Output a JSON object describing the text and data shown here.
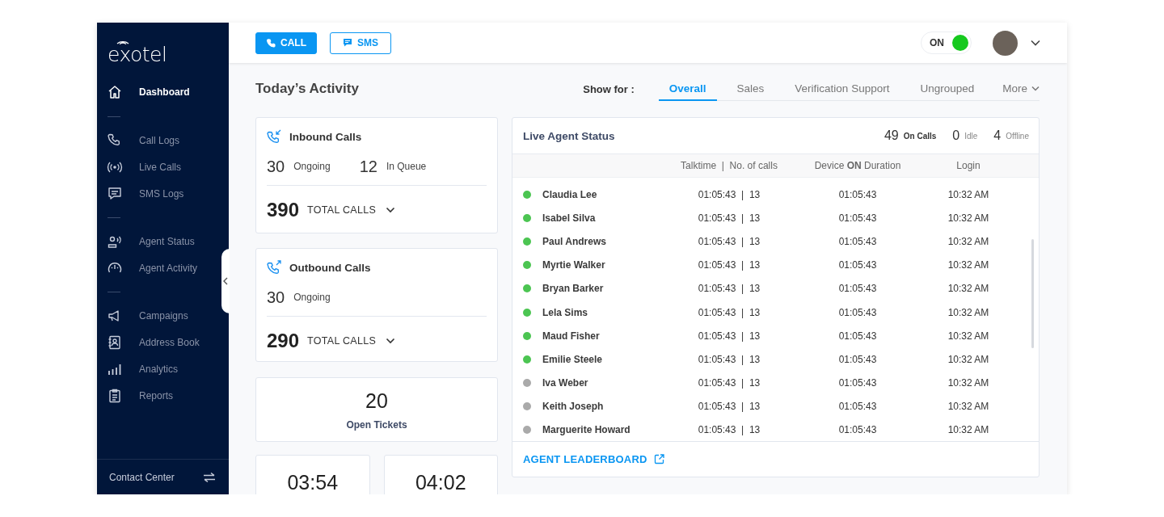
{
  "sidebar": {
    "logo": "exotel",
    "sections": [
      {
        "items": [
          {
            "label": "Dashboard",
            "selected": true
          }
        ]
      },
      {
        "items": [
          {
            "label": "Call Logs",
            "selected": false
          },
          {
            "label": "Live Calls",
            "selected": false
          },
          {
            "label": "SMS Logs",
            "selected": false
          }
        ]
      },
      {
        "items": [
          {
            "label": "Agent Status",
            "selected": false
          },
          {
            "label": "Agent Activity",
            "selected": false
          }
        ]
      },
      {
        "items": [
          {
            "label": "Campaigns",
            "selected": false
          },
          {
            "label": "Address Book",
            "selected": false
          },
          {
            "label": "Analytics",
            "selected": false
          },
          {
            "label": "Reports",
            "selected": false
          }
        ]
      }
    ],
    "footer": "Contact Center"
  },
  "topbar": {
    "buttons": [
      {
        "label": "CALL",
        "kind": "primary"
      },
      {
        "label": "SMS",
        "kind": "outline"
      }
    ],
    "status_toggle": {
      "label": "ON",
      "on": true
    }
  },
  "activity": {
    "title": "Today’s Activity",
    "show_for_label": "Show for :",
    "tabs": [
      {
        "label": "Overall",
        "selected": true
      },
      {
        "label": "Sales",
        "selected": false
      },
      {
        "label": "Verification Support",
        "selected": false
      },
      {
        "label": "Ungrouped",
        "selected": false
      }
    ],
    "more": "More"
  },
  "inbound": {
    "title": "Inbound Calls",
    "stats": [
      {
        "value": "30",
        "label": "Ongoing"
      },
      {
        "value": "12",
        "label": "In Queue"
      }
    ],
    "total": "390",
    "total_label": "TOTAL CALLS"
  },
  "outbound": {
    "title": "Outbound Calls",
    "stats": [
      {
        "value": "30",
        "label": "Ongoing"
      }
    ],
    "total": "290",
    "total_label": "TOTAL CALLS"
  },
  "tickets": {
    "value": "20",
    "label": "Open Tickets"
  },
  "timers": [
    "03:54",
    "04:02"
  ],
  "live_agent_status": {
    "title": "Live Agent Status",
    "summary": [
      {
        "value": "49",
        "label": "On Calls",
        "kind": "main"
      },
      {
        "value": "0",
        "label": "Idle",
        "kind": "minor"
      },
      {
        "value": "4",
        "label": "Offline",
        "kind": "minor"
      }
    ],
    "columns": [
      "Talktime  |  No. of calls",
      "Device **ON** Duration",
      "Login"
    ],
    "rows": [
      {
        "name": "Claudia Lee",
        "color": "#4cc552",
        "talktime": "01:05:43  |  13",
        "device_on": "01:05:43",
        "login": "10:32 AM"
      },
      {
        "name": "Isabel Silva",
        "color": "#4cc552",
        "talktime": "01:05:43  |  13",
        "device_on": "01:05:43",
        "login": "10:32 AM"
      },
      {
        "name": "Paul Andrews",
        "color": "#4cc552",
        "talktime": "01:05:43  |  13",
        "device_on": "01:05:43",
        "login": "10:32 AM"
      },
      {
        "name": "Myrtie Walker",
        "color": "#4cc552",
        "talktime": "01:05:43  |  13",
        "device_on": "01:05:43",
        "login": "10:32 AM"
      },
      {
        "name": "Bryan Barker",
        "color": "#4cc552",
        "talktime": "01:05:43  |  13",
        "device_on": "01:05:43",
        "login": "10:32 AM"
      },
      {
        "name": "Lela Sims",
        "color": "#4cc552",
        "talktime": "01:05:43  |  13",
        "device_on": "01:05:43",
        "login": "10:32 AM"
      },
      {
        "name": "Maud Fisher",
        "color": "#4cc552",
        "talktime": "01:05:43  |  13",
        "device_on": "01:05:43",
        "login": "10:32 AM"
      },
      {
        "name": "Emilie Steele",
        "color": "#4cc552",
        "talktime": "01:05:43  |  13",
        "device_on": "01:05:43",
        "login": "10:32 AM"
      },
      {
        "name": "Iva Weber",
        "color": "#aaaaaa",
        "talktime": "01:05:43  |  13",
        "device_on": "01:05:43",
        "login": "10:32 AM"
      },
      {
        "name": "Keith Joseph",
        "color": "#aaaaaa",
        "talktime": "01:05:43  |  13",
        "device_on": "01:05:43",
        "login": "10:32 AM"
      },
      {
        "name": "Marguerite Howard",
        "color": "#aaaaaa",
        "talktime": "01:05:43  |  13",
        "device_on": "01:05:43",
        "login": "10:32 AM"
      }
    ],
    "footer_link": "AGENT LEADERBOARD"
  }
}
